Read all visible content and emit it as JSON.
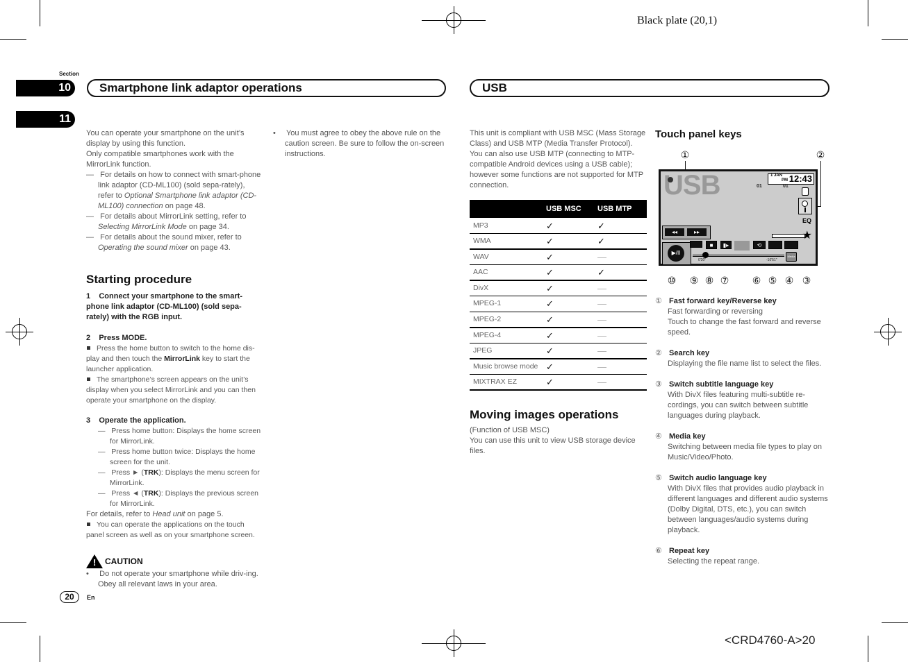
{
  "print_marks": {
    "plate": "Black plate (20,1)",
    "code": "<CRD4760-A>20"
  },
  "section": {
    "label": "Section",
    "tabs": [
      "10",
      "11"
    ]
  },
  "headers": {
    "left": "Smartphone link adaptor operations",
    "right": "USB"
  },
  "left_column": {
    "intro": [
      "You can operate your smartphone on the unit’s display by using this function.",
      "Only compatible smartphones work with the MirrorLink function."
    ],
    "refs": [
      {
        "pre": "For details on how to connect with smart-phone link adaptor (CD-ML100) (sold sepa-rately), refer to ",
        "link": "Optional Smartphone link adaptor (CD-ML100) connection",
        "post": " on page 48."
      },
      {
        "pre": "For details about MirrorLink setting, refer to ",
        "link": "Selecting MirrorLink Mode",
        "post": " on page 34."
      },
      {
        "pre": "For details about the sound mixer, refer to ",
        "link": "Operating the sound mixer",
        "post": " on page 43."
      }
    ],
    "starting_title": "Starting procedure",
    "step1": "1    Connect your smartphone to the smart-phone link adaptor (CD-ML100) (sold sepa-rately) with the RGB input.",
    "step2": "2    Press MODE.",
    "step2_notes": [
      {
        "pre": "Press the home button to switch to the home dis-play and then touch the ",
        "bold": "MirrorLink",
        "post": " key to start the launcher application."
      },
      {
        "pre": "The smartphone’s screen appears on the unit’s display when you select MirrorLink and you can then operate your smartphone on the display.",
        "bold": "",
        "post": ""
      }
    ],
    "step3": "3    Operate the application.",
    "step3_items": [
      {
        "pre": "Press home button: Displays the home screen for MirrorLink.",
        "bold": "",
        "post": ""
      },
      {
        "pre": "Press home button twice: Displays the home screen for the unit.",
        "bold": "",
        "post": ""
      },
      {
        "pre": "Press ► (",
        "bold": "TRK",
        "post": "): Displays the menu screen for MirrorLink."
      },
      {
        "pre": "Press ◄ (",
        "bold": "TRK",
        "post": "): Displays the previous screen for MirrorLink."
      }
    ],
    "details": {
      "pre": "For details, refer to ",
      "link": "Head unit",
      "post": " on page 5."
    },
    "touch_note": "You can operate the applications on the touch panel screen as well as on your smartphone screen.",
    "caution_label": "CAUTION",
    "caution_text": "Do not operate your smartphone while driv-ing. Obey all relevant laws in your area."
  },
  "middle_column": {
    "bullet": "You must agree to obey the above rule on the caution screen. Be sure to follow the on-screen instructions."
  },
  "usb_column": {
    "intro": [
      "This unit is compliant with USB MSC (Mass Storage Class) and USB MTP (Media Transfer Protocol).",
      "You can also use USB MTP (connecting to MTP-compatible Android devices using a USB cable); however some functions are not supported for MTP connection."
    ],
    "table": {
      "headers": [
        "",
        "USB MSC",
        "USB MTP"
      ],
      "rows": [
        [
          "MP3",
          "✓",
          "✓"
        ],
        [
          "WMA",
          "✓",
          "✓"
        ],
        [
          "WAV",
          "✓",
          "—"
        ],
        [
          "AAC",
          "✓",
          "✓"
        ],
        [
          "DivX",
          "✓",
          "—"
        ],
        [
          "MPEG-1",
          "✓",
          "—"
        ],
        [
          "MPEG-2",
          "✓",
          "—"
        ],
        [
          "MPEG-4",
          "✓",
          "—"
        ],
        [
          "JPEG",
          "✓",
          "—"
        ],
        [
          "Music browse mode",
          "✓",
          "—"
        ],
        [
          "MIXTRAX EZ",
          "✓",
          "—"
        ]
      ]
    },
    "moving_title": "Moving images operations",
    "moving_text": [
      "(Function of USB MSC)",
      "You can use this unit to view USB storage device files."
    ]
  },
  "touch_panel": {
    "title": "Touch panel keys",
    "screen": {
      "source": "USB",
      "date": "1 JAN",
      "ampm": "PM",
      "time": "12:43",
      "track_a": "01",
      "track_b": "01",
      "elapsed": "0'20\"",
      "remaining": "-10'51\"",
      "eq_label": "EQ",
      "media_label": "Media"
    },
    "callouts": [
      "①",
      "②",
      "⑩",
      "⑨",
      "⑧",
      "⑦",
      "⑥",
      "⑤",
      "④",
      "③"
    ],
    "keys": [
      {
        "num": "①",
        "title": "Fast forward key/Reverse key",
        "desc": "Fast forwarding or reversing\nTouch to change the fast forward and reverse speed."
      },
      {
        "num": "②",
        "title": "Search key",
        "desc": "Displaying the file name list to select the files."
      },
      {
        "num": "③",
        "title": "Switch subtitle language key",
        "desc": "With DivX files featuring multi-subtitle re-cordings, you can switch between subtitle languages during playback."
      },
      {
        "num": "④",
        "title": "Media key",
        "desc": "Switching between media file types to play on Music/Video/Photo."
      },
      {
        "num": "⑤",
        "title": "Switch audio language key",
        "desc": "With DivX files that provides audio playback in different languages and different audio systems (Dolby Digital, DTS, etc.), you can switch between languages/audio systems during playback."
      },
      {
        "num": "⑥",
        "title": "Repeat key",
        "desc": "Selecting the repeat range."
      }
    ]
  },
  "footer": {
    "page": "20",
    "lang": "En"
  }
}
